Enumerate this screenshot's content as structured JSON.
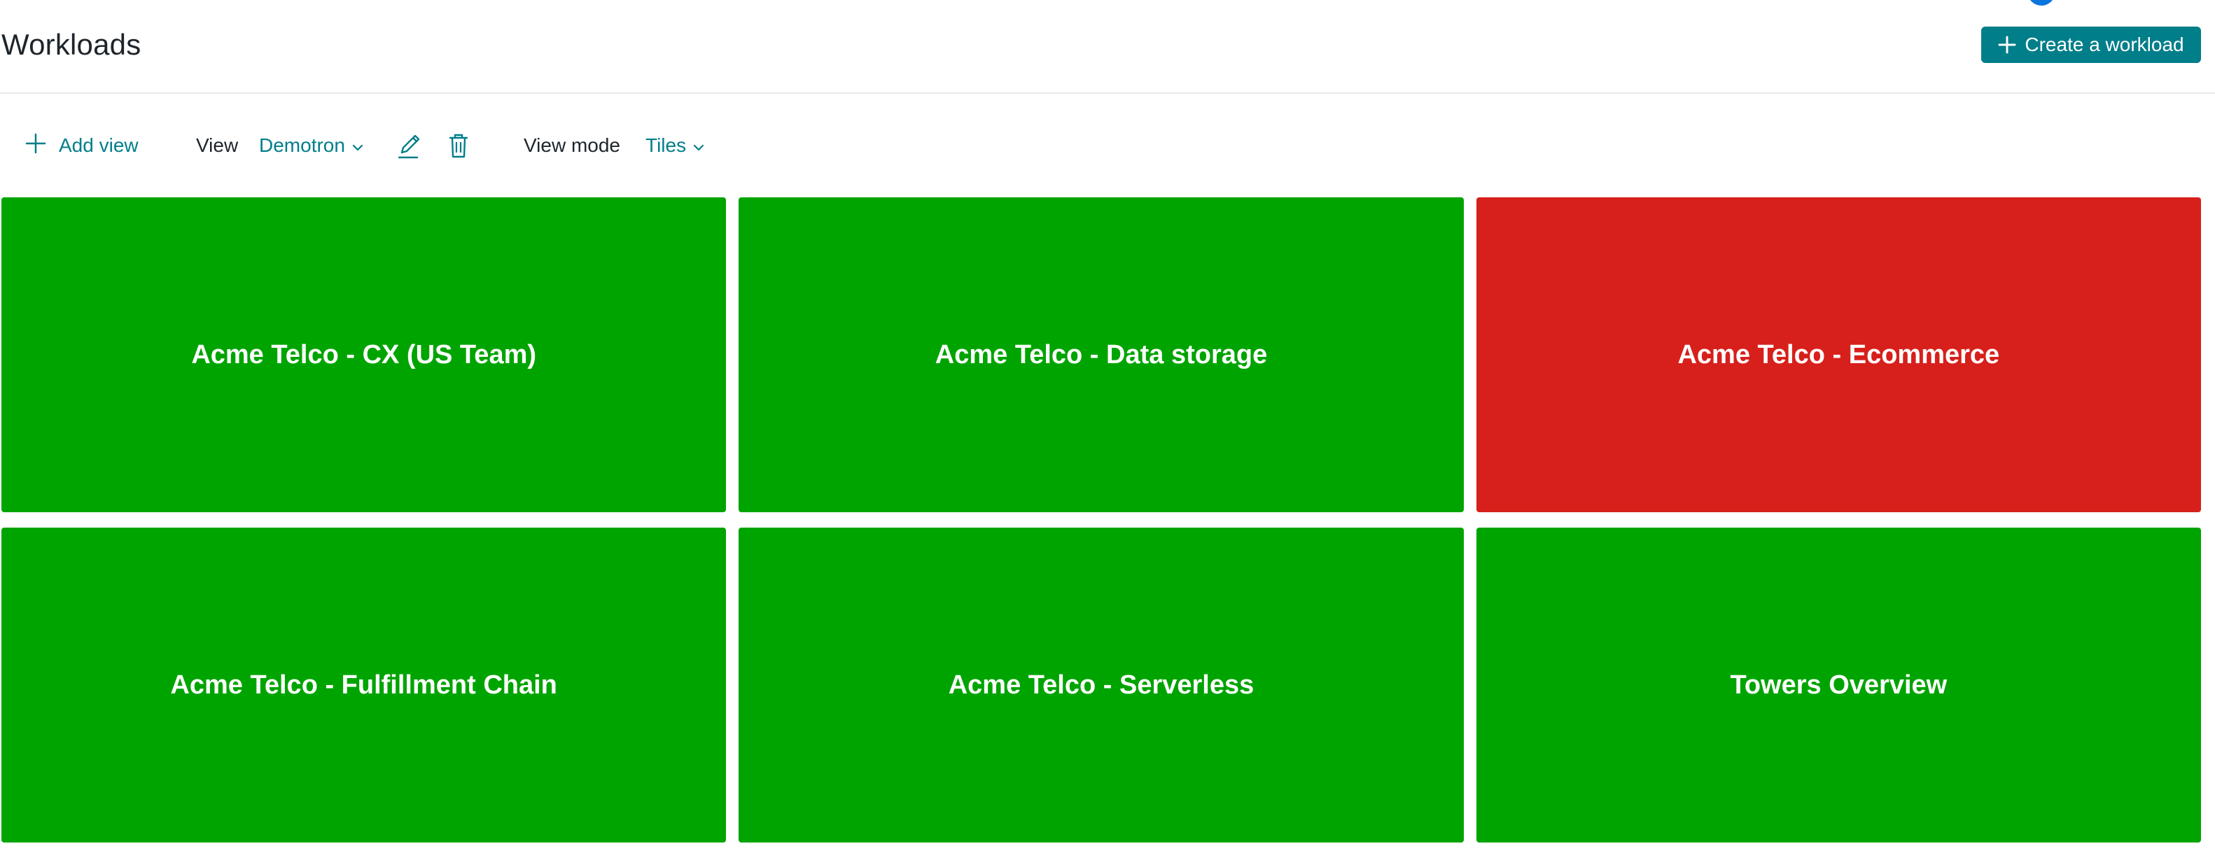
{
  "header": {
    "title": "Workloads",
    "create_label": "Create a workload"
  },
  "toolbar": {
    "add_view_label": "Add view",
    "view_label": "View",
    "view_value": "Demotron",
    "view_mode_label": "View mode",
    "view_mode_value": "Tiles",
    "icons": [
      "plus-icon",
      "chevron-down-icon",
      "pencil-icon",
      "trash-icon"
    ]
  },
  "colors": {
    "accent": "#007e8a",
    "healthy": "#00a400",
    "critical": "#d7201b"
  },
  "tiles": [
    {
      "name": "Acme Telco - CX (US Team)",
      "status": "healthy"
    },
    {
      "name": "Acme Telco - Data storage",
      "status": "healthy"
    },
    {
      "name": "Acme Telco - Ecommerce",
      "status": "critical"
    },
    {
      "name": "Acme Telco - Fulfillment Chain",
      "status": "healthy"
    },
    {
      "name": "Acme Telco - Serverless",
      "status": "healthy"
    },
    {
      "name": "Towers Overview",
      "status": "healthy"
    }
  ]
}
